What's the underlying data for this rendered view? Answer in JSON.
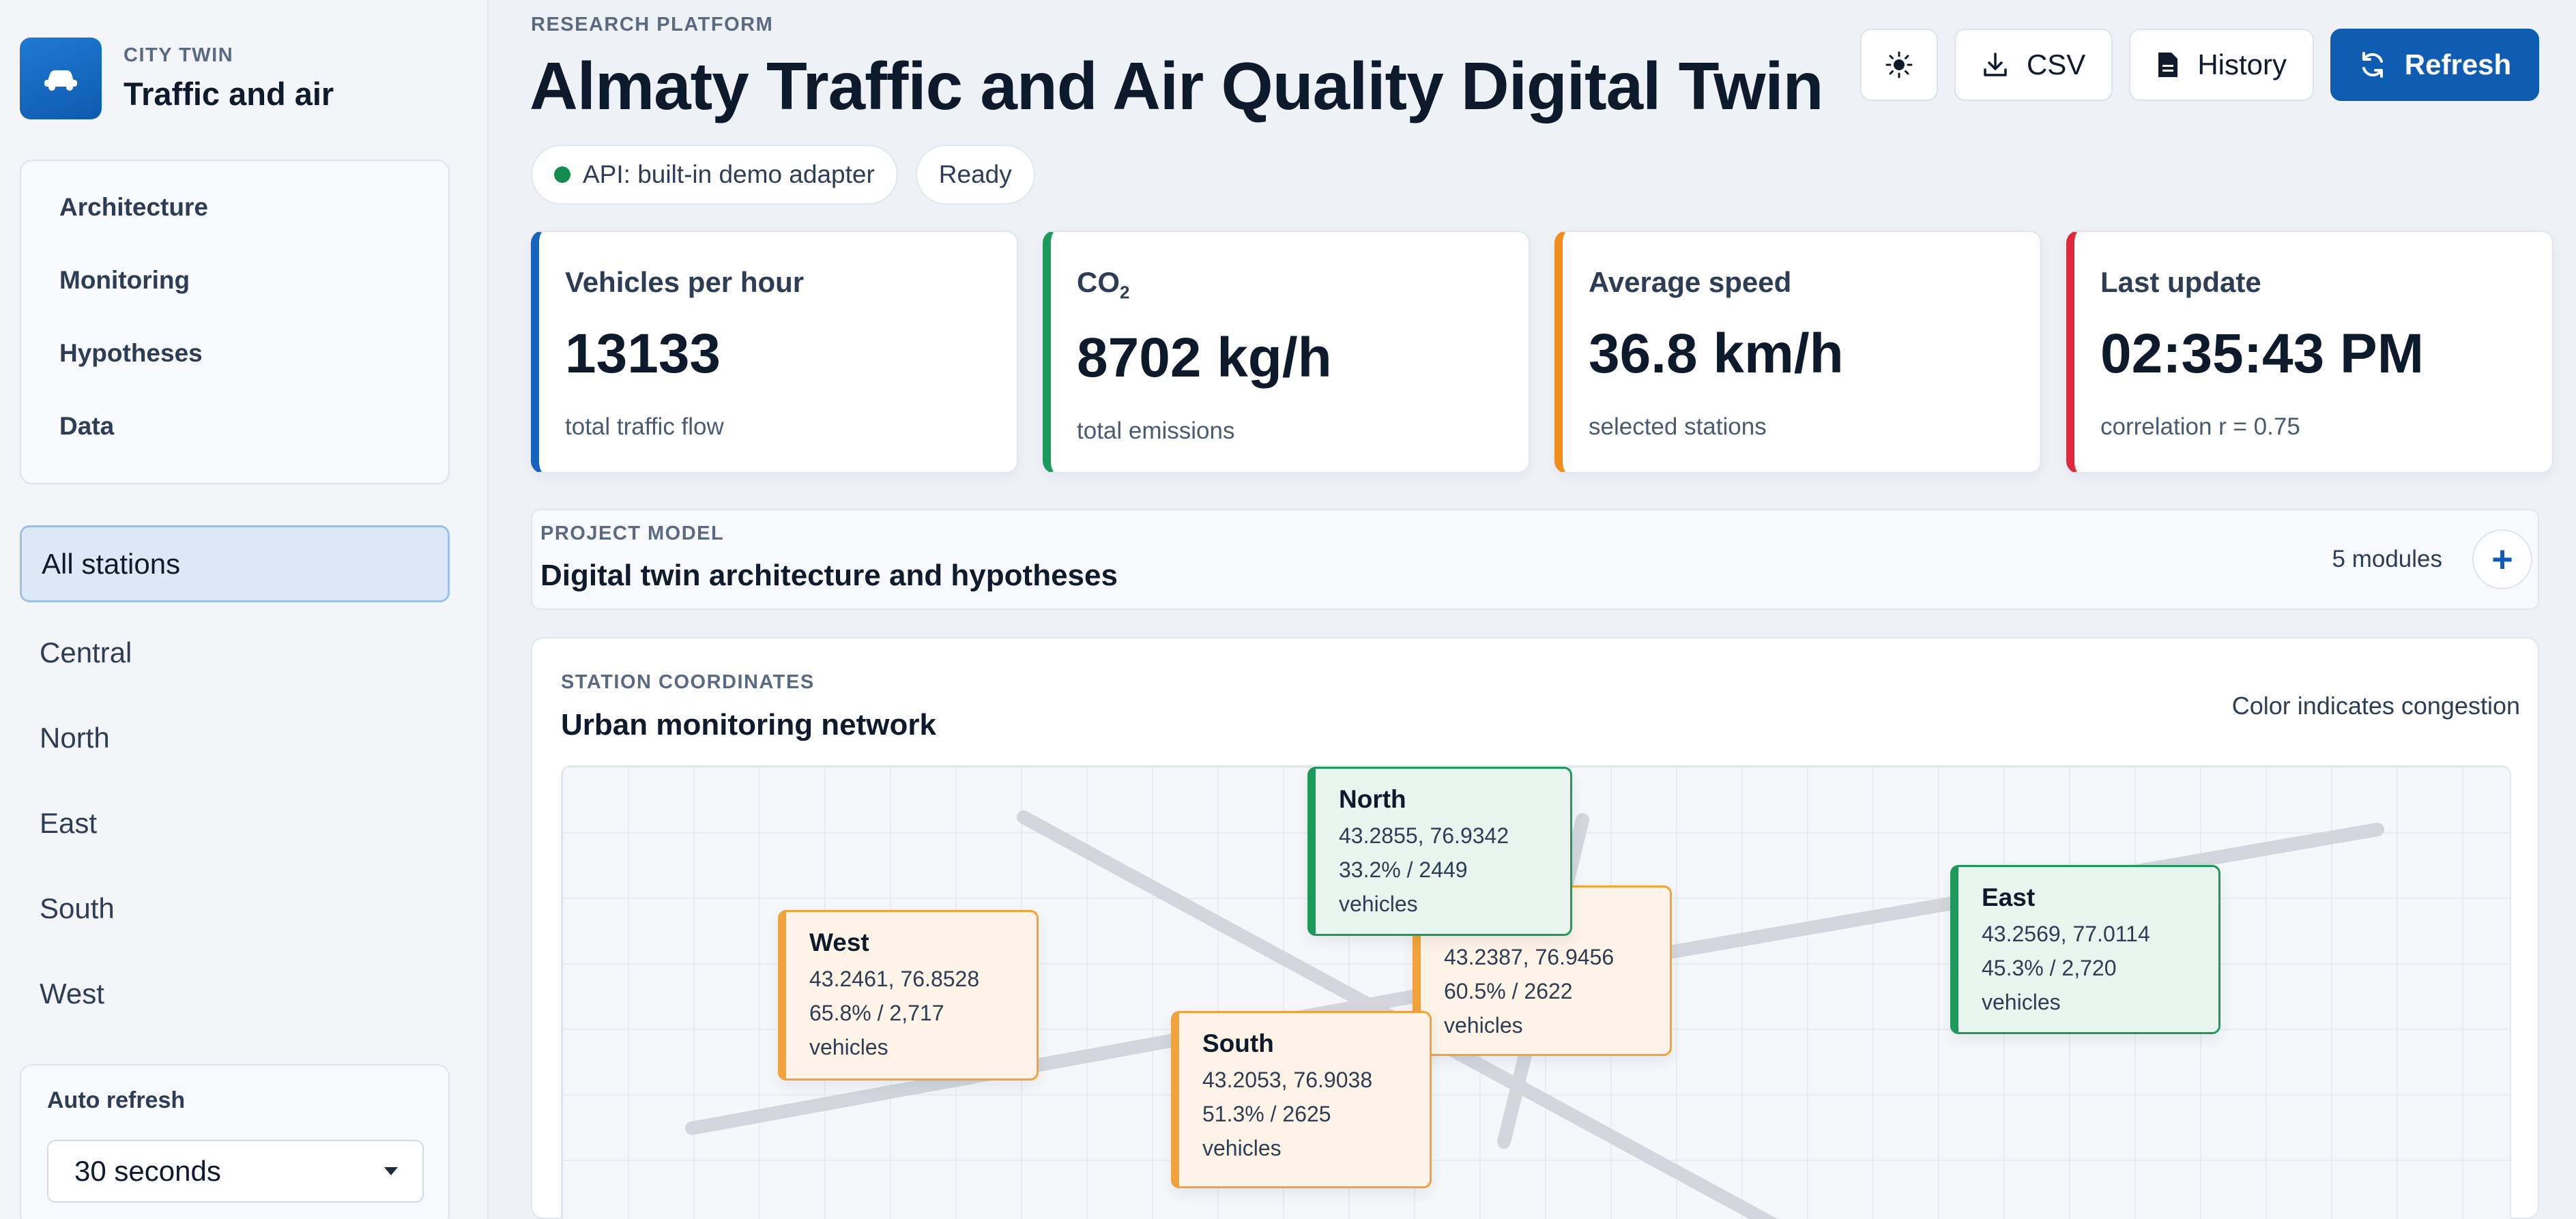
{
  "brand": {
    "kicker": "CITY TWIN",
    "title": "Traffic and air"
  },
  "nav": [
    "Architecture",
    "Monitoring",
    "Hypotheses",
    "Data"
  ],
  "stations": [
    "All stations",
    "Central",
    "North",
    "East",
    "South",
    "West"
  ],
  "selected_station": "All stations",
  "autorefresh": {
    "label": "Auto refresh",
    "value": "30 seconds"
  },
  "header": {
    "kicker": "RESEARCH PLATFORM",
    "title": "Almaty Traffic and Air Quality Digital Twin"
  },
  "toolbar": {
    "theme_icon": "sun-icon",
    "csv_label": "CSV",
    "history_label": "History",
    "refresh_label": "Refresh"
  },
  "status": {
    "api": "API: built-in demo adapter",
    "state": "Ready",
    "api_color": "#138a4f"
  },
  "kpis": [
    {
      "label": "Vehicles per hour",
      "value": "13133",
      "sub": "total traffic flow",
      "accent": "#1565c0"
    },
    {
      "label": "CO",
      "label_sub": "2",
      "value": "8702 kg/h",
      "sub": "total emissions",
      "accent": "#1c9a5b"
    },
    {
      "label": "Average speed",
      "value": "36.8 km/h",
      "sub": "selected stations",
      "accent": "#f28c1a"
    },
    {
      "label": "Last update",
      "value": "02:35:43 PM",
      "sub": "correlation r = 0.75",
      "accent": "#e0283c"
    }
  ],
  "project": {
    "kicker": "PROJECT MODEL",
    "title": "Digital twin architecture and hypotheses",
    "modules": "5 modules",
    "add_label": "+"
  },
  "network": {
    "kicker": "STATION COORDINATES",
    "title": "Urban monitoring network",
    "note": "Color indicates congestion"
  },
  "map_cards": {
    "west": {
      "name": "West",
      "coords": "43.2461, 76.8528",
      "stats": "65.8% / 2,717",
      "unit": "vehicles"
    },
    "south": {
      "name": "South",
      "coords": "43.2053, 76.9038",
      "stats": "51.3% / 2625",
      "unit": "vehicles"
    },
    "central": {
      "name": "",
      "coords": "43.2387, 76.9456",
      "stats": "60.5% / 2622",
      "unit": "vehicles"
    },
    "north": {
      "name": "North",
      "coords": "43.2855, 76.9342",
      "stats": "33.2% / 2449",
      "unit": "vehicles"
    },
    "east": {
      "name": "East",
      "coords": "43.2569, 77.0114",
      "stats": "45.3% / 2,720",
      "unit": "vehicles"
    }
  },
  "congestion_colors": {
    "high": "#f2a23a",
    "low": "#1c9a5b"
  }
}
